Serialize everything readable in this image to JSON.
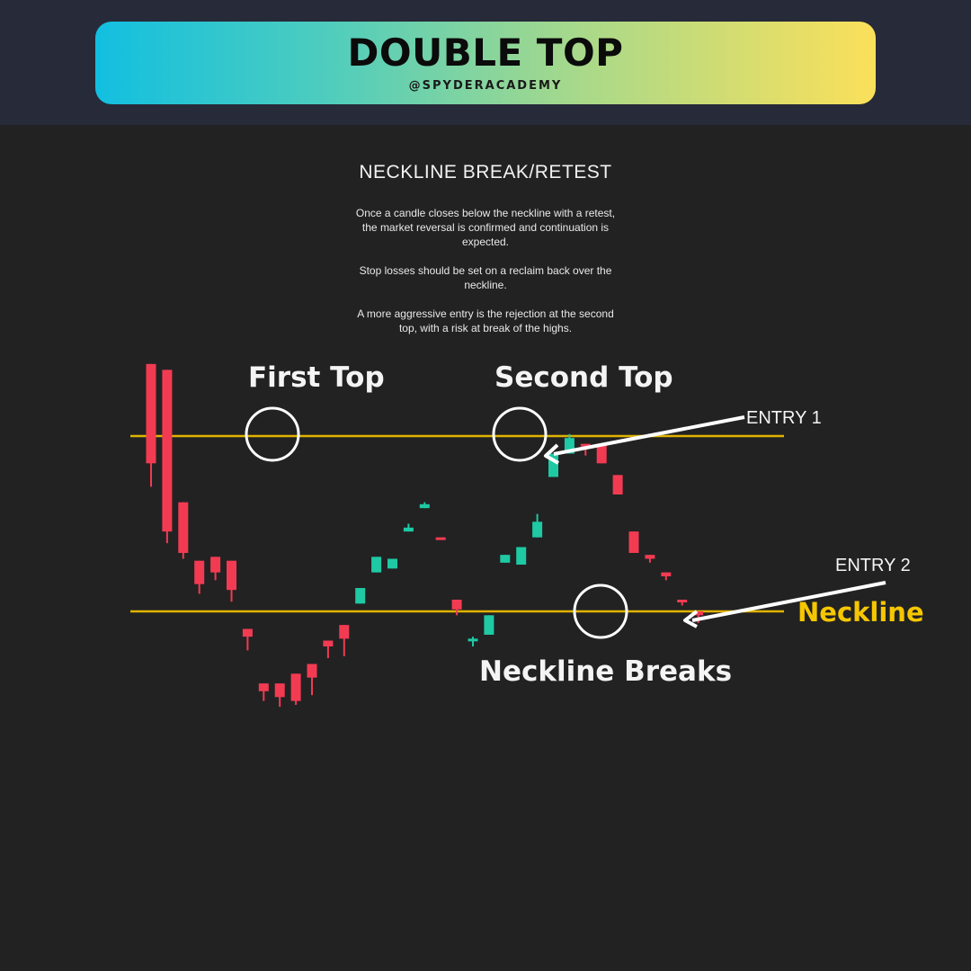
{
  "header": {
    "title": "DOUBLE TOP",
    "handle": "@SPYDERACADEMY"
  },
  "section": {
    "title": "NECKLINE BREAK/RETEST",
    "paragraphs": [
      "Once a candle closes below the neckline with a retest, the market reversal is confirmed and continuation is expected.",
      "Stop losses should be set on a reclaim back over the neckline.",
      "A more aggressive entry is the rejection at the second top, with a risk at break of the highs."
    ]
  },
  "colors": {
    "bull": "#1ec9a4",
    "bear": "#f23b52",
    "level_line": "#e0b300",
    "neckline_label": "#f6c700",
    "annotation": "#ffffff"
  },
  "chart_data": {
    "type": "candlestick",
    "title": "",
    "y_scale": "price (unlabeled)",
    "grid": false,
    "candles": [
      {
        "o": 10.7,
        "h": 10.6,
        "l": 4.4,
        "c": 5.6
      },
      {
        "o": 10.4,
        "h": 10.1,
        "l": 1.5,
        "c": 2.1
      },
      {
        "o": 3.6,
        "h": 2.1,
        "l": 0.7,
        "c": 1.0
      },
      {
        "o": 0.6,
        "h": 0.4,
        "l": -1.1,
        "c": -0.6
      },
      {
        "o": 0.8,
        "h": 0.8,
        "l": -0.4,
        "c": 0.0
      },
      {
        "o": 0.6,
        "h": 0.6,
        "l": -1.5,
        "c": -0.9
      },
      {
        "o": -2.9,
        "h": -3.0,
        "l": -4.0,
        "c": -3.3
      },
      {
        "o": -5.7,
        "h": -5.9,
        "l": -6.6,
        "c": -6.1
      },
      {
        "o": -5.7,
        "h": -6.5,
        "l": -6.9,
        "c": -6.4
      },
      {
        "o": -5.2,
        "h": -6.2,
        "l": -6.8,
        "c": -6.6
      },
      {
        "o": -4.7,
        "h": -4.9,
        "l": -6.3,
        "c": -5.4
      },
      {
        "o": -3.5,
        "h": -3.6,
        "l": -4.4,
        "c": -3.8
      },
      {
        "o": -2.7,
        "h": -2.8,
        "l": -4.3,
        "c": -3.4
      },
      {
        "o": -1.6,
        "h": -1.3,
        "l": -1.0,
        "c": -0.8
      },
      {
        "o": 0.0,
        "h": 0.4,
        "l": 0.1,
        "c": 0.8
      },
      {
        "o": 0.2,
        "h": 0.4,
        "l": 1.2,
        "c": 0.7
      },
      {
        "o": 2.1,
        "h": 2.5,
        "l": 2.7,
        "c": 2.3
      },
      {
        "o": 3.3,
        "h": 3.6,
        "l": 3.8,
        "c": 3.5
      },
      {
        "o": 1.8,
        "h": 1.8,
        "l": 1.8,
        "c": 1.8
      },
      {
        "o": -1.4,
        "h": -1.7,
        "l": -2.2,
        "c": -1.9
      },
      {
        "o": -3.5,
        "h": -3.3,
        "l": -3.8,
        "c": -3.4
      },
      {
        "o": -3.2,
        "h": -2.5,
        "l": -2.7,
        "c": -2.2
      },
      {
        "o": 0.5,
        "h": 0.9,
        "l": 1.3,
        "c": 0.9
      },
      {
        "o": 0.4,
        "h": 1.1,
        "l": 1.3,
        "c": 1.3
      },
      {
        "o": 1.8,
        "h": 3.0,
        "l": 2.2,
        "c": 2.6
      },
      {
        "o": 4.9,
        "h": 6.1,
        "l": 5.4,
        "c": 6.1
      },
      {
        "o": 6.1,
        "h": 7.1,
        "l": 6.4,
        "c": 6.9
      },
      {
        "o": 6.6,
        "h": 6.5,
        "l": 6.0,
        "c": 6.6
      },
      {
        "o": 6.6,
        "h": 5.8,
        "l": 5.6,
        "c": 5.6
      },
      {
        "o": 5.0,
        "h": 4.2,
        "l": 4.4,
        "c": 4.0
      },
      {
        "o": 2.1,
        "h": 1.2,
        "l": 1.5,
        "c": 1.0
      },
      {
        "o": 0.9,
        "h": 0.6,
        "l": 0.5,
        "c": 0.7
      },
      {
        "o": 0.0,
        "h": -0.1,
        "l": -0.4,
        "c": -0.2
      },
      {
        "o": -1.4,
        "h": -1.5,
        "l": -1.7,
        "c": -1.4
      },
      {
        "o": -2.0,
        "h": -2.1,
        "l": -2.6,
        "c": -2.2
      }
    ],
    "levels": [
      {
        "name": "top",
        "y": 7.0
      },
      {
        "name": "neckline",
        "y": -2.0
      }
    ],
    "annotations": [
      {
        "text": "First Top"
      },
      {
        "text": "Second Top"
      },
      {
        "text": "Neckline Breaks"
      },
      {
        "text": "Neckline"
      },
      {
        "text": "ENTRY 1"
      },
      {
        "text": "ENTRY 2"
      }
    ]
  }
}
